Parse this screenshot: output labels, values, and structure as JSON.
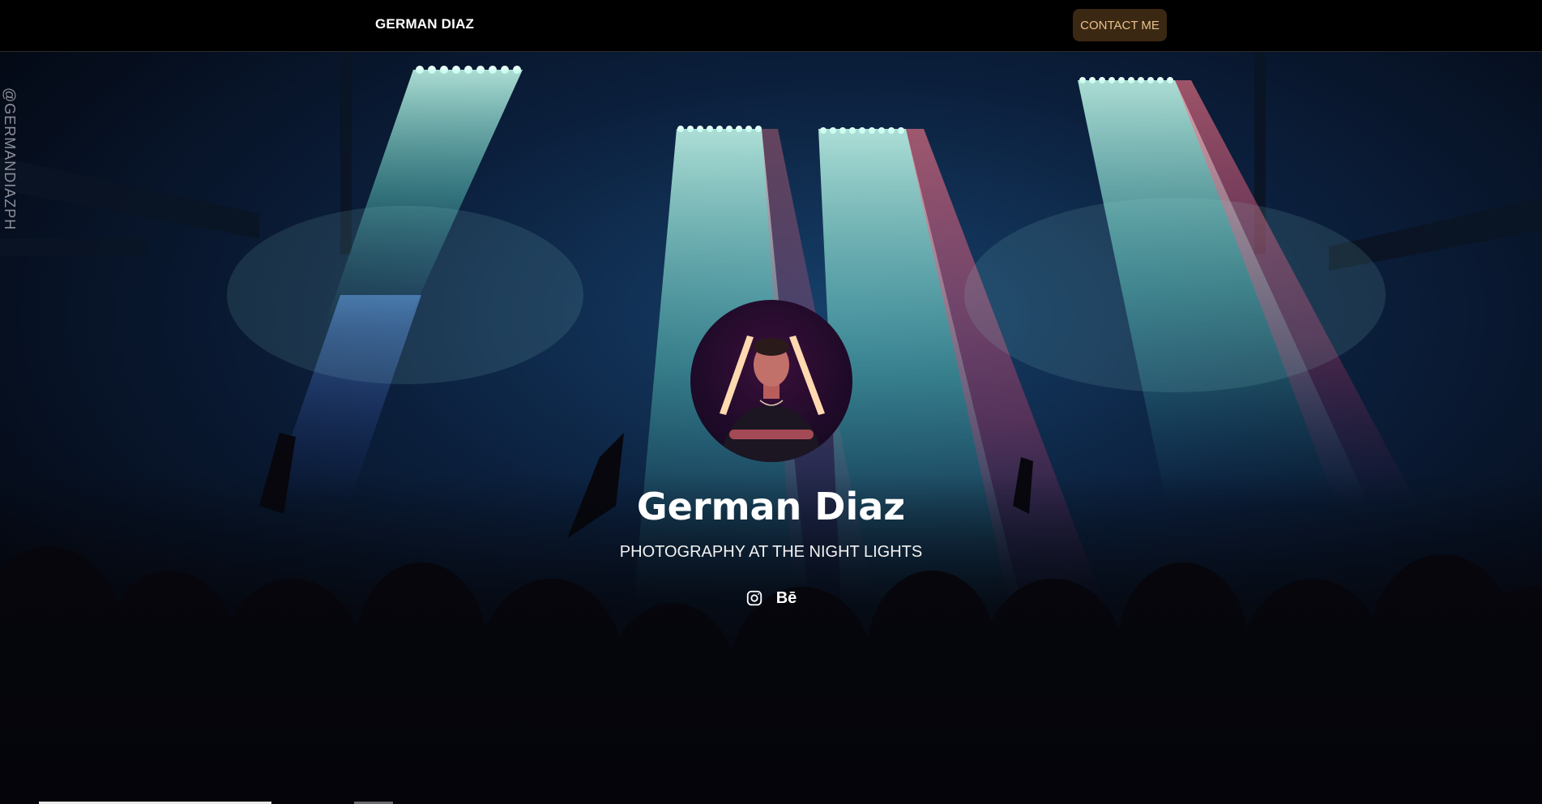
{
  "header": {
    "brand": "GERMAN DIAZ",
    "contact_label": "CONTACT ME"
  },
  "side": {
    "handle": "@GERMANDIAZPH"
  },
  "hero": {
    "name": "German Diaz",
    "tagline": "PHOTOGRAPHY AT THE NIGHT LIGHTS",
    "socials": [
      {
        "name": "instagram",
        "icon": "instagram-icon"
      },
      {
        "name": "behance",
        "icon": "behance-icon",
        "label": "Bē"
      }
    ]
  },
  "colors": {
    "header_bg": "#000000",
    "button_bg": "#3b2813",
    "button_text": "#e8c28a",
    "text": "#ffffff"
  }
}
